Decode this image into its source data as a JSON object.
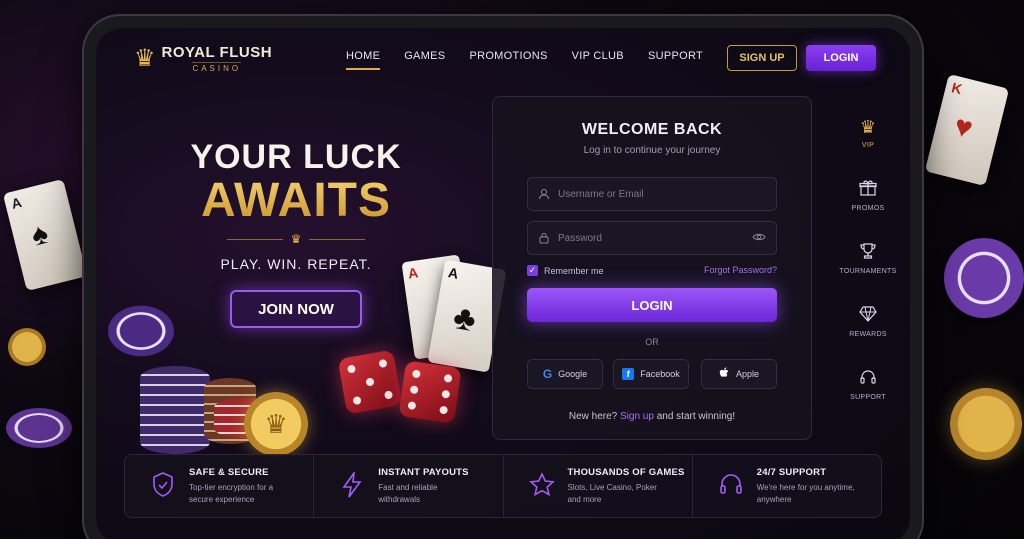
{
  "brand": {
    "name": "ROYAL FLUSH",
    "sub": "CASINO"
  },
  "nav": {
    "items": [
      {
        "label": "HOME"
      },
      {
        "label": "GAMES"
      },
      {
        "label": "PROMOTIONS"
      },
      {
        "label": "VIP CLUB"
      },
      {
        "label": "SUPPORT"
      }
    ],
    "signup_label": "SIGN UP",
    "login_label": "LOGIN"
  },
  "hero": {
    "line1": "YOUR LUCK",
    "line2": "AWAITS",
    "tagline": "PLAY. WIN. REPEAT.",
    "cta": "JOIN NOW"
  },
  "login": {
    "title": "WELCOME BACK",
    "subtitle": "Log in to continue your journey",
    "username_placeholder": "Username or Email",
    "password_placeholder": "Password",
    "remember_label": "Remember me",
    "remember_checked": true,
    "forgot_label": "Forgot Password?",
    "submit_label": "LOGIN",
    "or_label": "OR",
    "social": [
      {
        "label": "Google",
        "icon": "google-icon"
      },
      {
        "label": "Facebook",
        "icon": "facebook-icon"
      },
      {
        "label": "Apple",
        "icon": "apple-icon"
      }
    ],
    "new_here_prefix": "New here?",
    "signup_link": "Sign up",
    "new_here_suffix": "and start winning!"
  },
  "sidebar": {
    "items": [
      {
        "label": "VIP",
        "icon": "crown-icon"
      },
      {
        "label": "PROMOS",
        "icon": "gift-icon"
      },
      {
        "label": "TOURNAMENTS",
        "icon": "trophy-icon"
      },
      {
        "label": "REWARDS",
        "icon": "diamond-icon"
      },
      {
        "label": "SUPPORT",
        "icon": "headset-icon"
      }
    ]
  },
  "features": [
    {
      "title": "SAFE & SECURE",
      "desc": "Top-tier encryption for a secure experience",
      "icon": "shield-icon"
    },
    {
      "title": "INSTANT PAYOUTS",
      "desc": "Fast and reliable withdrawals",
      "icon": "lightning-icon"
    },
    {
      "title": "THOUSANDS OF GAMES",
      "desc": "Slots, Live Casino, Poker and more",
      "icon": "star-icon"
    },
    {
      "title": "24/7 SUPPORT",
      "desc": "We're here for you anytime, anywhere",
      "icon": "headset-icon"
    }
  ],
  "decor": {
    "card_left": {
      "rank": "A",
      "suit": "♠"
    },
    "card_right": {
      "rank": "K",
      "suit": "♥"
    },
    "hero_card_1": {
      "rank": "A"
    },
    "hero_card_2": {
      "rank": "A",
      "suit": "♣"
    }
  },
  "colors": {
    "accent": "#8a3ef0",
    "gold": "#e3b447",
    "background": "#0b0810"
  }
}
